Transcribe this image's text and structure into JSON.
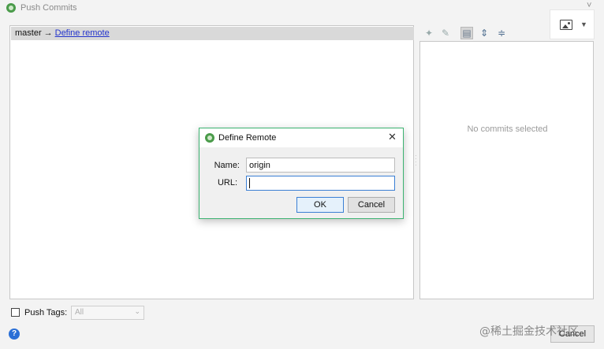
{
  "window": {
    "title": "Push Commits",
    "icon": "git-logo-icon",
    "menu_chevron": "˅"
  },
  "commits_panel": {
    "branch": "master",
    "arrow": "→",
    "define_remote_link": "Define remote"
  },
  "details_panel": {
    "empty_text": "No commits selected"
  },
  "toolbar": {
    "items": [
      "cherry-pick-icon",
      "edit-icon",
      "details-icon",
      "expand-all-icon",
      "collapse-all-icon"
    ]
  },
  "bottom": {
    "push_tags_label": "Push Tags:",
    "tags_value": "All",
    "help": "?",
    "cancel_label": "Cancel",
    "watermark": "@稀土掘金技术社区"
  },
  "dialog": {
    "title": "Define Remote",
    "close": "✕",
    "name_label": "Name:",
    "name_value": "origin",
    "url_label": "URL:",
    "url_value": "",
    "ok_label": "OK",
    "cancel_label": "Cancel"
  },
  "colors": {
    "dialog_border": "#3cb371",
    "focus_border": "#3b7fd4",
    "link": "#2233cc",
    "branch_bar": "#d9d9d9"
  }
}
